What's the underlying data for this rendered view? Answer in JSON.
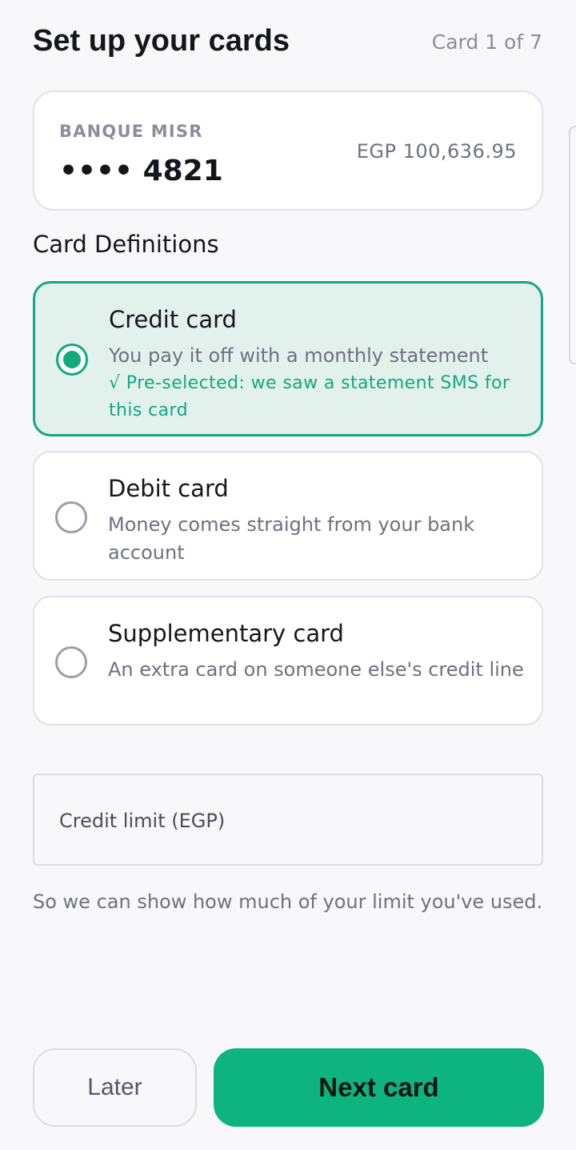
{
  "header": {
    "title": "Set up your cards",
    "counter": "Card 1 of 7"
  },
  "account": {
    "bank_name": "BANQUE MISR",
    "masked_number": "•••• 4821",
    "balance": "EGP 100,636.95"
  },
  "definitions": {
    "section_title": "Card Definitions",
    "selected": "credit",
    "options": [
      {
        "id": "credit",
        "title": "Credit card",
        "description": "You pay it off with a monthly statement",
        "note": "√ Pre-selected: we saw a statement SMS for this card"
      },
      {
        "id": "debit",
        "title": "Debit card",
        "description": "Money comes straight from your bank account"
      },
      {
        "id": "supplementary",
        "title": "Supplementary card",
        "description": "An extra card on someone else's credit line"
      }
    ]
  },
  "credit_limit": {
    "label": "Credit limit (EGP)",
    "value": "",
    "helper": "So we can show how much of your limit you've used."
  },
  "actions": {
    "later_label": "Later",
    "next_label": "Next card"
  },
  "colors": {
    "accent": "#12a97c",
    "primary_button": "#0db47f",
    "selected_bg": "#e3f1ed",
    "page_bg": "#f8f8fb"
  }
}
